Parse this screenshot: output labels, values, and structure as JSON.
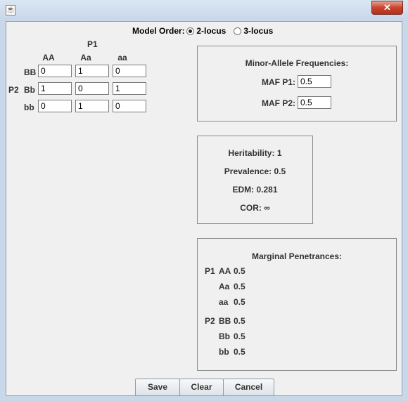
{
  "window": {
    "app_icon_glyph": "☕",
    "close_glyph": "✕"
  },
  "model_order": {
    "label": "Model Order:",
    "options": [
      "2-locus",
      "3-locus"
    ],
    "selected": "2-locus"
  },
  "grid": {
    "p1_label": "P1",
    "p2_label": "P2",
    "col_headers": [
      "AA",
      "Aa",
      "aa"
    ],
    "row_headers": [
      "BB",
      "Bb",
      "bb"
    ],
    "cells": [
      [
        "0",
        "1",
        "0"
      ],
      [
        "1",
        "0",
        "1"
      ],
      [
        "0",
        "1",
        "0"
      ]
    ]
  },
  "maf": {
    "title": "Minor-Allele Frequencies:",
    "p1_label": "MAF P1:",
    "p1_value": "0.5",
    "p2_label": "MAF P2:",
    "p2_value": "0.5"
  },
  "stats": {
    "heritability_label": "Heritability:",
    "heritability_value": "1",
    "prevalence_label": "Prevalence:",
    "prevalence_value": "0.5",
    "edm_label": "EDM:",
    "edm_value": "0.281",
    "cor_label": "COR:",
    "cor_value": "∞"
  },
  "marginal": {
    "title": "Marginal Penetrances:",
    "p1_label": "P1",
    "p1_rows": [
      {
        "g": "AA",
        "v": "0.5"
      },
      {
        "g": "Aa",
        "v": "0.5"
      },
      {
        "g": "aa",
        "v": "0.5"
      }
    ],
    "p2_label": "P2",
    "p2_rows": [
      {
        "g": "BB",
        "v": "0.5"
      },
      {
        "g": "Bb",
        "v": "0.5"
      },
      {
        "g": "bb",
        "v": "0.5"
      }
    ]
  },
  "buttons": {
    "save": "Save",
    "clear": "Clear",
    "cancel": "Cancel"
  }
}
